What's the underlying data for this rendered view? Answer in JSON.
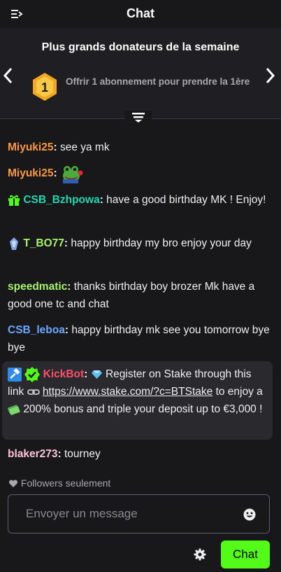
{
  "header": {
    "title": "Chat"
  },
  "donors": {
    "heading": "Plus grands donateurs de la semaine",
    "badge_number": "1",
    "offer_text": "Offrir 1 abonnement pour prendre la 1ère"
  },
  "messages": [
    {
      "user": "Miyuki25",
      "color": "#ff9a3c",
      "text": "see ya mk"
    },
    {
      "user": "Miyuki25",
      "color": "#ff9a3c",
      "text": "",
      "emote": "frog-with-rose-emote"
    },
    {
      "user": "CSB_Bzhpowa",
      "color": "#1fd8b0",
      "badge": "gift-icon",
      "text": "have a good birthday MK ! Enjoy!"
    },
    {
      "user": "T_BO77",
      "color": "#a7f36a",
      "badge": "gem-icon",
      "text": "happy birthday my bro enjoy your day"
    },
    {
      "user": "speedmatic",
      "color": "#a7f36a",
      "text": "thanks birthday boy brozer Mk have a good one tc and chat"
    },
    {
      "user": "CSB_leboa",
      "color": "#6aa9ff",
      "text": "happy birthday mk see you tomorrow bye bye"
    },
    {
      "user": "KickBot",
      "color": "#ff4d6a",
      "badges": [
        "moderator-icon",
        "verified-icon"
      ],
      "text_part1": "Register on Stake through this link",
      "link": "https://www.stake.com/?c=BTStake",
      "text_part2": "to enjoy a",
      "text_part3": "200% bonus and triple your deposit up to €3,000 !"
    },
    {
      "user": "blaker273",
      "color": "#ffc2d8",
      "text": "tourney"
    }
  ],
  "footer": {
    "followers_only": "Followers seulement",
    "input_placeholder": "Envoyer un message",
    "send_label": "Chat"
  },
  "colors": {
    "accent": "#53fc18",
    "background": "#18181b"
  }
}
